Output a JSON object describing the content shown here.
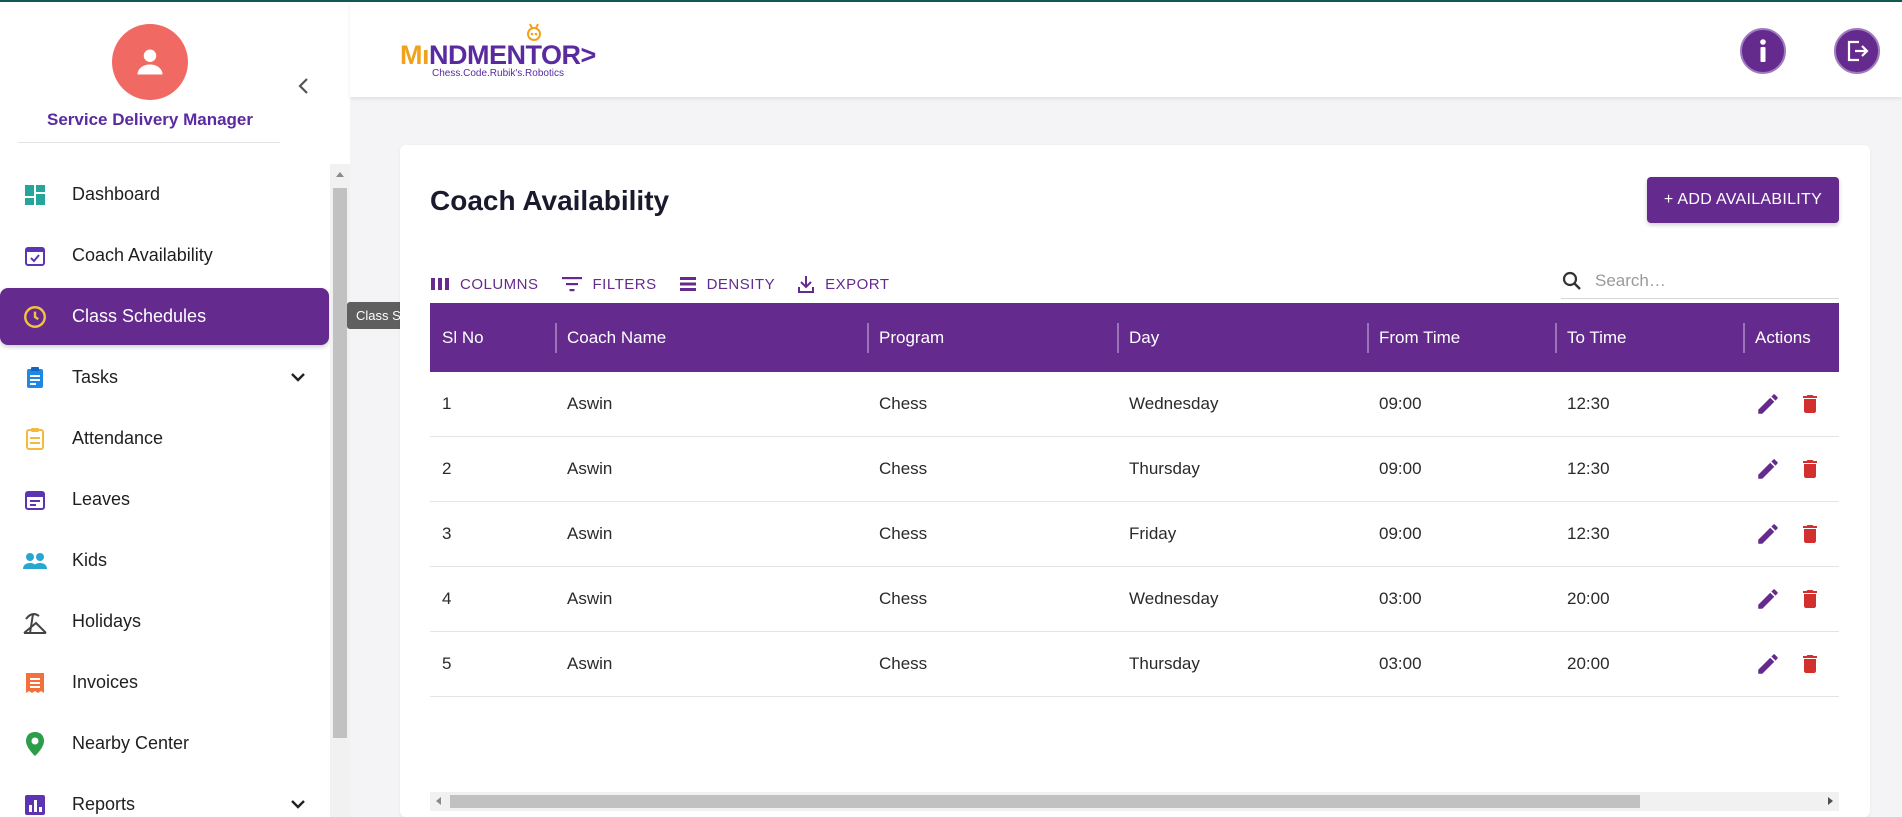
{
  "sidebar": {
    "role": "Service Delivery Manager",
    "items": [
      {
        "label": "Dashboard",
        "icon": "dashboard-icon"
      },
      {
        "label": "Coach Availability",
        "icon": "calendar-check-icon"
      },
      {
        "label": "Class Schedules",
        "icon": "clock-icon",
        "active": true
      },
      {
        "label": "Tasks",
        "icon": "clipboard-icon",
        "expandable": true
      },
      {
        "label": "Attendance",
        "icon": "attendance-icon"
      },
      {
        "label": "Leaves",
        "icon": "calendar-icon"
      },
      {
        "label": "Kids",
        "icon": "people-icon"
      },
      {
        "label": "Holidays",
        "icon": "beach-icon"
      },
      {
        "label": "Invoices",
        "icon": "receipt-icon"
      },
      {
        "label": "Nearby Center",
        "icon": "location-pin-icon"
      },
      {
        "label": "Reports",
        "icon": "bar-chart-icon",
        "expandable": true
      }
    ],
    "tooltip": "Class Schedules"
  },
  "header": {
    "logo_text_1": "M",
    "logo_text_2": "NDMENTOR",
    "logo_tagline": "Chess.Code.Rubik's.Robotics",
    "info_icon": "info-icon",
    "logout_icon": "logout-icon"
  },
  "page": {
    "title": "Coach Availability",
    "add_button": "+ ADD AVAILABILITY"
  },
  "toolbar": {
    "columns": "COLUMNS",
    "filters": "FILTERS",
    "density": "DENSITY",
    "export": "EXPORT",
    "search_placeholder": "Search…"
  },
  "table": {
    "columns": [
      "Sl No",
      "Coach Name",
      "Program",
      "Day",
      "From Time",
      "To Time",
      "Actions"
    ],
    "rows": [
      [
        "1",
        "Aswin",
        "Chess",
        "Wednesday",
        "09:00",
        "12:30"
      ],
      [
        "2",
        "Aswin",
        "Chess",
        "Thursday",
        "09:00",
        "12:30"
      ],
      [
        "3",
        "Aswin",
        "Chess",
        "Friday",
        "09:00",
        "12:30"
      ],
      [
        "4",
        "Aswin",
        "Chess",
        "Wednesday",
        "03:00",
        "20:00"
      ],
      [
        "5",
        "Aswin",
        "Chess",
        "Thursday",
        "03:00",
        "20:00"
      ]
    ]
  },
  "colors": {
    "primary": "#652a8d",
    "avatar": "#f06a63",
    "delete": "#d32f2f"
  }
}
